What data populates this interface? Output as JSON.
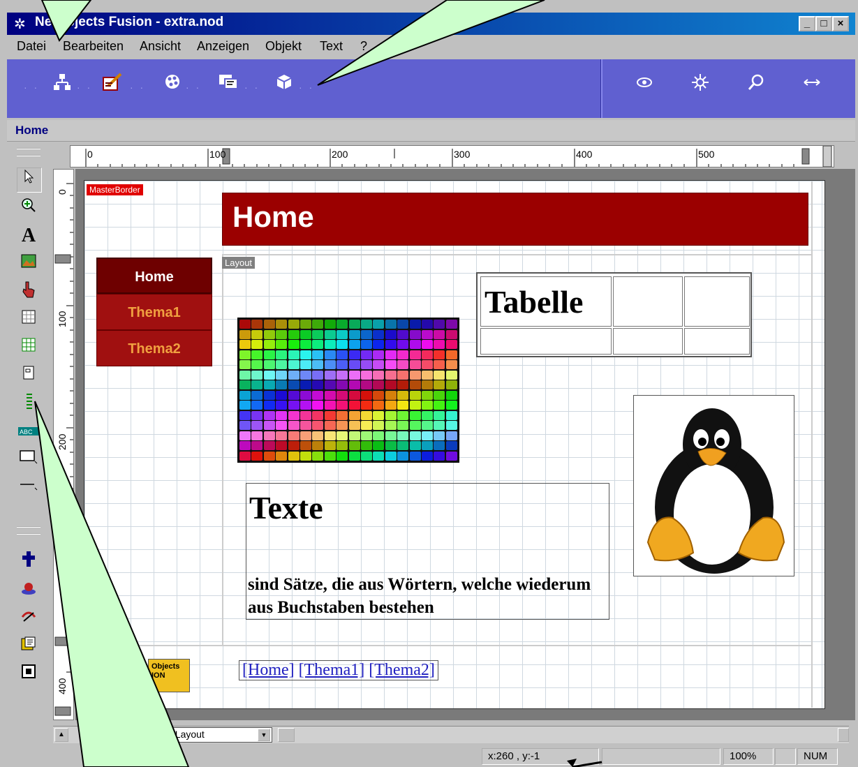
{
  "window": {
    "title": "NetObjects Fusion - extra.nod",
    "app_icon": "netobjects-star-icon"
  },
  "menu": [
    "Datei",
    "Bearbeiten",
    "Ansicht",
    "Anzeigen",
    "Objekt",
    "Text",
    "?"
  ],
  "toolbar_icons": [
    "site-view-icon",
    "page-view-icon",
    "style-view-icon",
    "assets-view-icon",
    "publish-view-icon",
    "preview-icon",
    "settings-icon",
    "zoom-icon",
    "navigate-icon"
  ],
  "breadcrumb": "Home",
  "ruler": {
    "h_labels": [
      "0",
      "100",
      "200",
      "300",
      "400",
      "500"
    ],
    "v_labels": [
      "0",
      "100",
      "200",
      "400"
    ]
  },
  "page": {
    "masterborder_label": "MasterBorder",
    "banner_title": "Home",
    "layout_label": "Layout",
    "nav": [
      "Home",
      "Thema1",
      "Thema2"
    ],
    "table_title": "Tabelle",
    "text_heading": "Texte",
    "text_body": "sind Sätze, die aus Wörtern, welche wiederum aus Buchstaben bestehen",
    "footer_links": [
      "[Home]",
      "[Thema1]",
      "[Thema2]"
    ],
    "logo_text": "Objects\nION"
  },
  "bottom": {
    "layout_select": "eLayout"
  },
  "status": {
    "coords": "x:260 , y:-1",
    "zoom": "100%",
    "num": "NUM"
  },
  "colors": {
    "titlebar": "#000080",
    "toolbar": "#6060d0",
    "banner": "#9b0000",
    "nav_active": "#6e0000",
    "nav_inactive": "#a01010",
    "nav_inactive_text": "#f0a040",
    "callout": "#ccffcc"
  }
}
